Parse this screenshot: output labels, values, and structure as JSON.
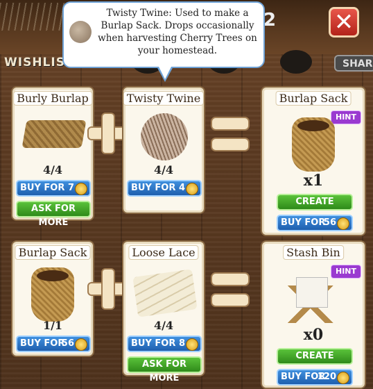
{
  "header": {
    "counter_text": "2",
    "close_label": "✕",
    "wishlist_label": "WISHLIST",
    "share_label": "SHAR"
  },
  "tooltip": {
    "text": "Twisty Twine: Used to make a Burlap Sack. Drops occasionally when harvesting Cherry Trees on your homestead."
  },
  "recipes": [
    {
      "ingredients": [
        {
          "name": "Burly Burlap",
          "count": "4/4",
          "buy_label": "BUY FOR",
          "price": "7",
          "ask_label": "ASK FOR MORE"
        },
        {
          "name": "Twisty Twine",
          "count": "4/4",
          "buy_label": "BUY FOR",
          "price": "4"
        }
      ],
      "result": {
        "name": "Burlap Sack",
        "hint": "HINT",
        "quantity": "x1",
        "create_label": "CREATE",
        "buy_label": "BUY FOR",
        "price": "56"
      }
    },
    {
      "ingredients": [
        {
          "name": "Burlap Sack",
          "count": "1/1",
          "buy_label": "BUY FOR",
          "price": "56"
        },
        {
          "name": "Loose Lace",
          "count": "4/4",
          "buy_label": "BUY FOR",
          "price": "8",
          "ask_label": "ASK FOR MORE"
        }
      ],
      "result": {
        "name": "Stash Bin",
        "hint": "HINT",
        "quantity": "x0",
        "create_label": "CREATE",
        "buy_label": "BUY FOR",
        "price": "120"
      }
    }
  ],
  "icons": {
    "currency": "horseshoe-coin-icon",
    "plus": "plus-icon",
    "equals": "equals-icon"
  },
  "colors": {
    "buy_button": "#2a72c8",
    "green_button": "#3fa325",
    "hint_badge": "#9a3ad0",
    "close_button": "#d1362b"
  }
}
